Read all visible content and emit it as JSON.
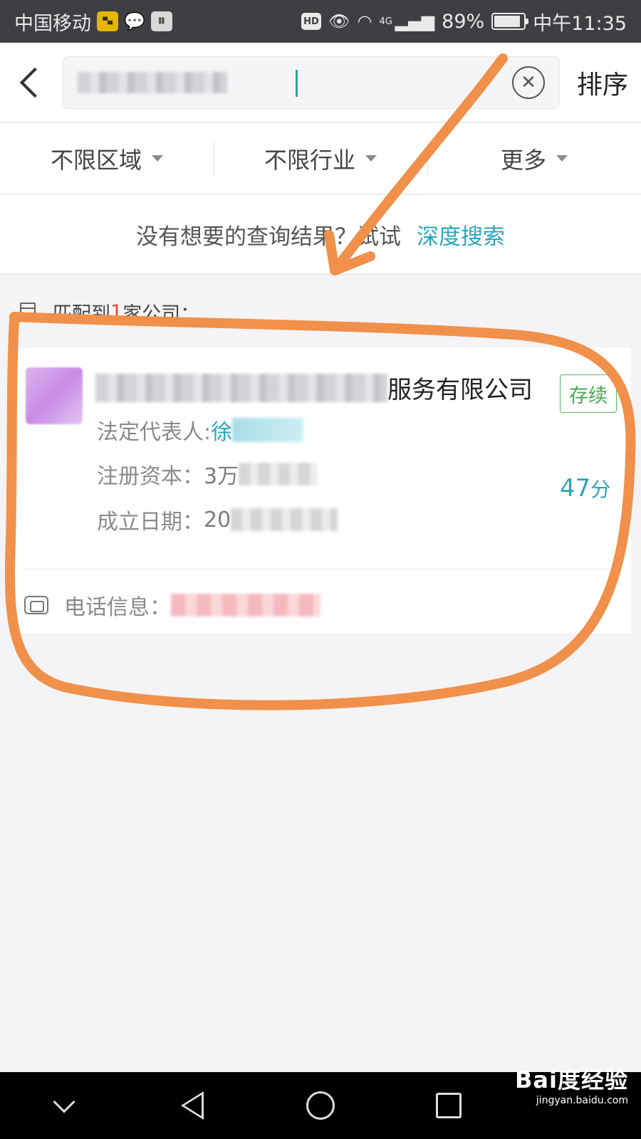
{
  "status_bar": {
    "carrier": "中国移动",
    "network": "4G",
    "battery": "89%",
    "battery_level": 0.89,
    "time": "中午11:35",
    "hd_badge": "HD",
    "icons": [
      "app-badge-icon",
      "chat-bubble-icon",
      "link-icon",
      "eye-icon",
      "wifi-icon",
      "signal-icon",
      "battery-icon"
    ]
  },
  "header": {
    "back_icon": "chevron-left-icon",
    "search_value": "",
    "clear_icon": "close-circle-icon",
    "sort_label": "排序"
  },
  "filters": {
    "items": [
      {
        "label": "不限区域"
      },
      {
        "label": "不限行业"
      },
      {
        "label": "更多"
      }
    ]
  },
  "hint": {
    "text": "没有想要的查询结果？试试",
    "link": "深度搜索"
  },
  "results": {
    "prefix": "匹配到",
    "count": "1",
    "suffix": "家公司："
  },
  "card": {
    "company_name_visible": "服务有限公司",
    "status": "存续",
    "legal_rep_label": "法定代表人:",
    "legal_rep_value": "徐",
    "capital_label": "注册资本：",
    "capital_value": "3万",
    "date_label": "成立日期：",
    "date_value": "20",
    "score": "47",
    "score_unit": "分",
    "phone_label": "电话信息："
  },
  "annotation": {
    "color": "#f0904a"
  },
  "watermark": {
    "logo": "Bai度经验",
    "url": "jingyan.baidu.com"
  }
}
